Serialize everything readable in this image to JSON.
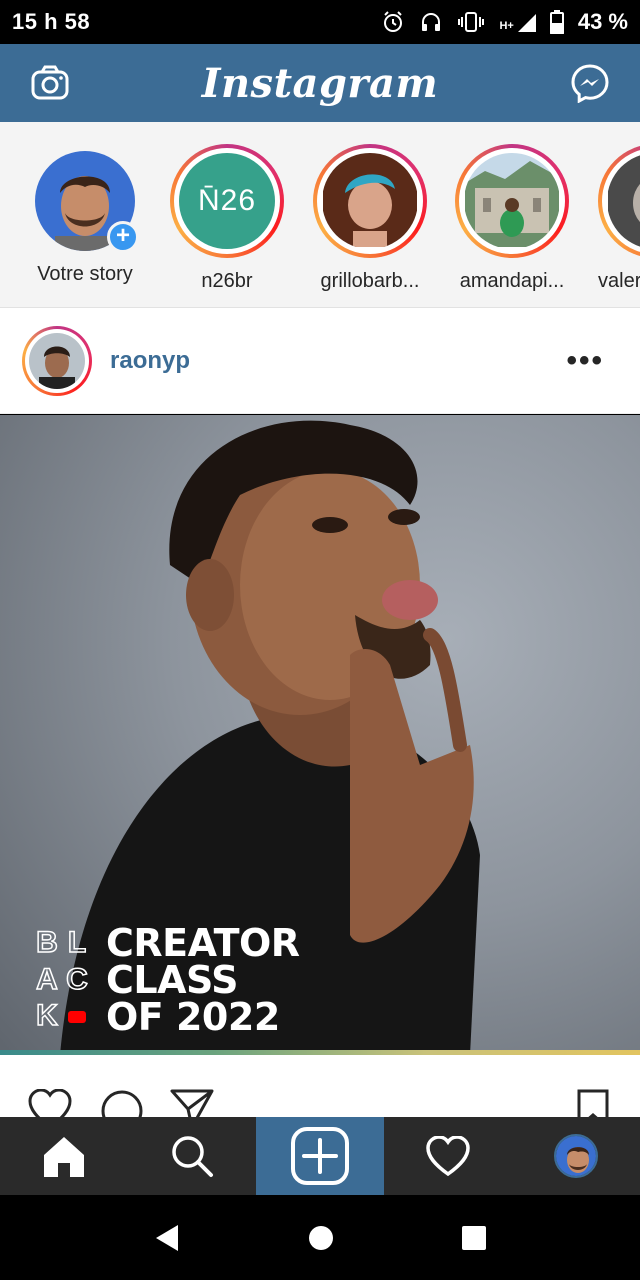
{
  "status_bar": {
    "time": "15 h 58",
    "network": "H+",
    "battery": "43 %"
  },
  "top_bar": {
    "logo": "Instagram",
    "left_icon": "camera-icon",
    "right_icon": "messenger-icon"
  },
  "stories": [
    {
      "name": "Votre story",
      "own": true
    },
    {
      "name": "n26br",
      "badge_text": "N̄26"
    },
    {
      "name": "grillobarb..."
    },
    {
      "name": "amandapi..."
    },
    {
      "name": "valer"
    }
  ],
  "post": {
    "username": "raonyp",
    "more": "•••",
    "overlay": {
      "logo_letters": [
        "B",
        "L",
        "A",
        "C",
        "K",
        ""
      ],
      "lines": [
        "CREATOR",
        "CLASS",
        "OF 2022"
      ]
    }
  },
  "bottom_nav": [
    "home-icon",
    "search-icon",
    "add-icon",
    "heart-icon",
    "profile-avatar"
  ],
  "colors": {
    "header_blue": "#3c6c95",
    "story_plus": "#3897f0",
    "n26_teal": "#36a18b"
  }
}
